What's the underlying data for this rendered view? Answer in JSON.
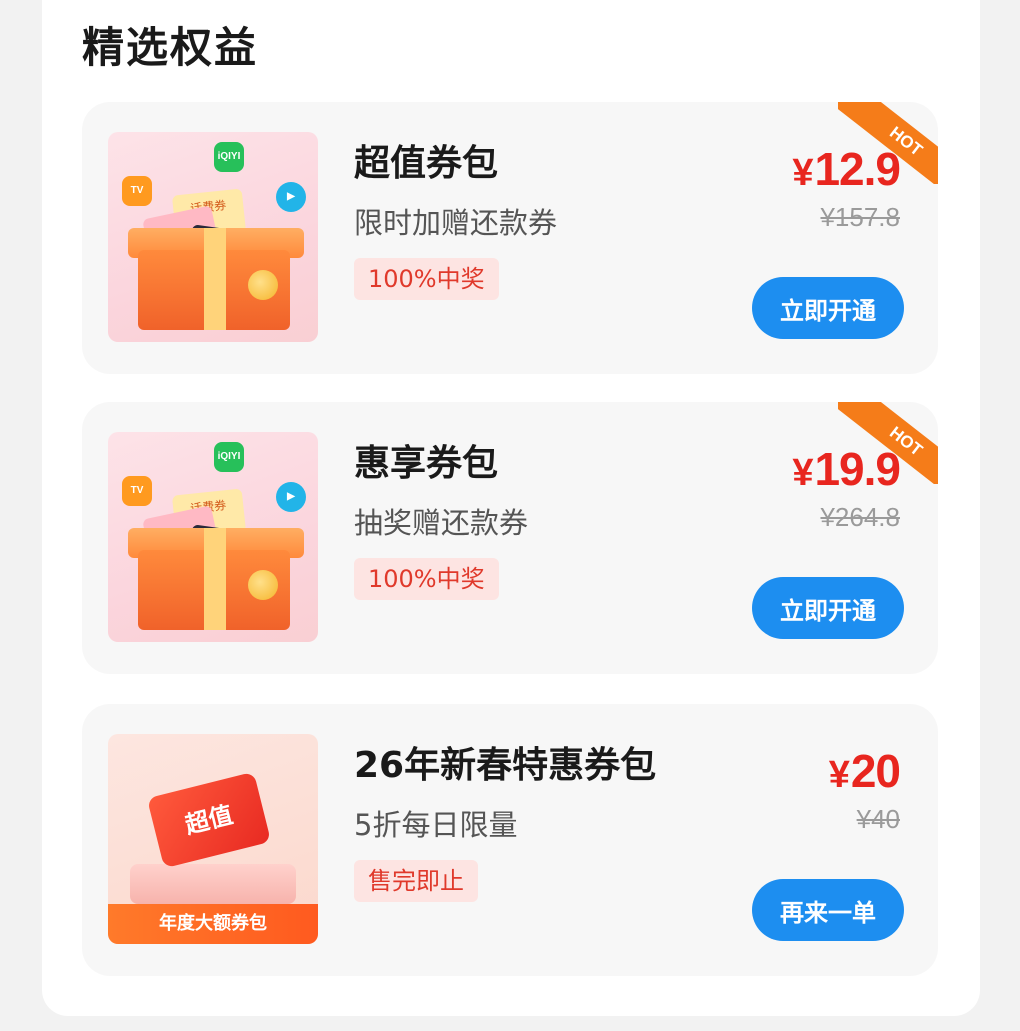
{
  "section": {
    "title": "精选权益"
  },
  "cards": [
    {
      "title": "超值券包",
      "subtitle": "限时加赠还款券",
      "tag": "100%中奖",
      "price": "12.9",
      "currency": "¥",
      "original_price": "¥157.8",
      "button": "立即开通",
      "badge": "HOT",
      "thumb": {
        "ticket_text": "话费券",
        "app": "iQIYI"
      }
    },
    {
      "title": "惠享券包",
      "subtitle": "抽奖赠还款券",
      "tag": "100%中奖",
      "price": "19.9",
      "currency": "¥",
      "original_price": "¥264.8",
      "button": "立即开通",
      "badge": "HOT",
      "thumb": {
        "ticket_text": "话费券",
        "app": "iQIYI"
      }
    },
    {
      "title": "26年新春特惠券包",
      "subtitle": "5折每日限量",
      "tag": "售完即止",
      "price": "20",
      "currency": "¥",
      "original_price": "¥40",
      "button": "再来一单",
      "thumb": {
        "card_text": "超值",
        "label": "年度大额券包"
      }
    }
  ],
  "colors": {
    "price": "#e8261f",
    "button": "#1d8ef0",
    "hot_badge": "#f57c19",
    "tag_text": "#e0392b"
  }
}
